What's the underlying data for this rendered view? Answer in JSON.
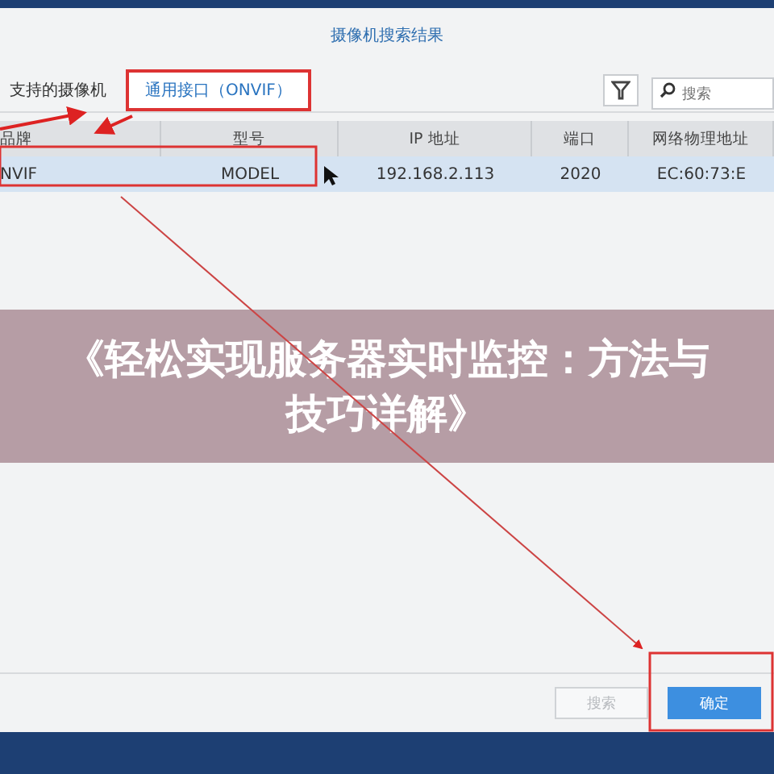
{
  "dialog": {
    "title": "摄像机搜索结果"
  },
  "tabs": [
    {
      "label": "支持的摄像机",
      "selected": false
    },
    {
      "label": "通用接口（ONVIF）",
      "selected": true
    }
  ],
  "search": {
    "placeholder": "搜索"
  },
  "table": {
    "columns": [
      "品牌",
      "型号",
      "IP 地址",
      "端口",
      "网络物理地址"
    ],
    "rows": [
      {
        "cells": [
          "NVIF",
          "MODEL",
          "192.168.2.113",
          "2020",
          "EC:60:73:E"
        ],
        "selected": true
      }
    ]
  },
  "buttons": [
    {
      "label": "搜索",
      "disabled": true
    },
    {
      "label": "确定",
      "disabled": false
    }
  ],
  "banner": {
    "text": "《轻松实现服务器实时监控：方法与技巧详解》"
  }
}
